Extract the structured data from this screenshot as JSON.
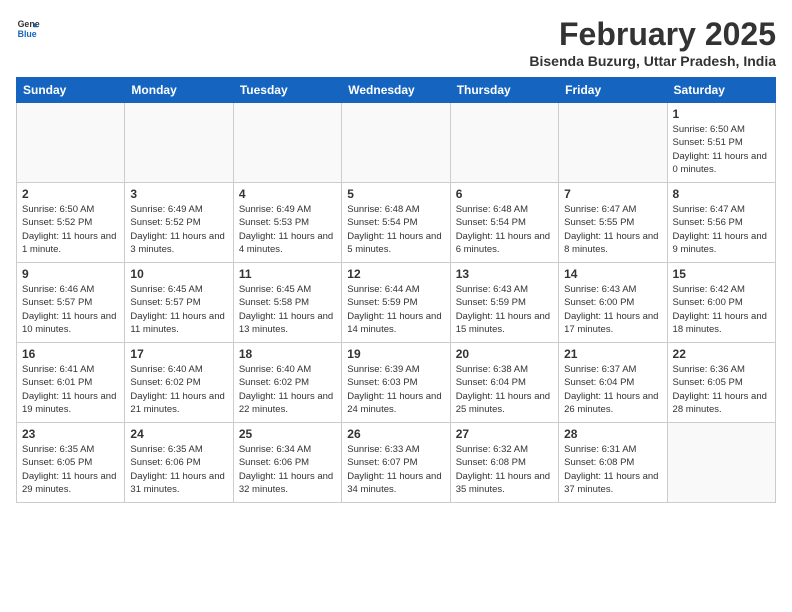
{
  "header": {
    "logo_general": "General",
    "logo_blue": "Blue",
    "month_title": "February 2025",
    "location": "Bisenda Buzurg, Uttar Pradesh, India"
  },
  "weekdays": [
    "Sunday",
    "Monday",
    "Tuesday",
    "Wednesday",
    "Thursday",
    "Friday",
    "Saturday"
  ],
  "weeks": [
    [
      {
        "day": "",
        "info": ""
      },
      {
        "day": "",
        "info": ""
      },
      {
        "day": "",
        "info": ""
      },
      {
        "day": "",
        "info": ""
      },
      {
        "day": "",
        "info": ""
      },
      {
        "day": "",
        "info": ""
      },
      {
        "day": "1",
        "info": "Sunrise: 6:50 AM\nSunset: 5:51 PM\nDaylight: 11 hours\nand 0 minutes."
      }
    ],
    [
      {
        "day": "2",
        "info": "Sunrise: 6:50 AM\nSunset: 5:52 PM\nDaylight: 11 hours\nand 1 minute."
      },
      {
        "day": "3",
        "info": "Sunrise: 6:49 AM\nSunset: 5:52 PM\nDaylight: 11 hours\nand 3 minutes."
      },
      {
        "day": "4",
        "info": "Sunrise: 6:49 AM\nSunset: 5:53 PM\nDaylight: 11 hours\nand 4 minutes."
      },
      {
        "day": "5",
        "info": "Sunrise: 6:48 AM\nSunset: 5:54 PM\nDaylight: 11 hours\nand 5 minutes."
      },
      {
        "day": "6",
        "info": "Sunrise: 6:48 AM\nSunset: 5:54 PM\nDaylight: 11 hours\nand 6 minutes."
      },
      {
        "day": "7",
        "info": "Sunrise: 6:47 AM\nSunset: 5:55 PM\nDaylight: 11 hours\nand 8 minutes."
      },
      {
        "day": "8",
        "info": "Sunrise: 6:47 AM\nSunset: 5:56 PM\nDaylight: 11 hours\nand 9 minutes."
      }
    ],
    [
      {
        "day": "9",
        "info": "Sunrise: 6:46 AM\nSunset: 5:57 PM\nDaylight: 11 hours\nand 10 minutes."
      },
      {
        "day": "10",
        "info": "Sunrise: 6:45 AM\nSunset: 5:57 PM\nDaylight: 11 hours\nand 11 minutes."
      },
      {
        "day": "11",
        "info": "Sunrise: 6:45 AM\nSunset: 5:58 PM\nDaylight: 11 hours\nand 13 minutes."
      },
      {
        "day": "12",
        "info": "Sunrise: 6:44 AM\nSunset: 5:59 PM\nDaylight: 11 hours\nand 14 minutes."
      },
      {
        "day": "13",
        "info": "Sunrise: 6:43 AM\nSunset: 5:59 PM\nDaylight: 11 hours\nand 15 minutes."
      },
      {
        "day": "14",
        "info": "Sunrise: 6:43 AM\nSunset: 6:00 PM\nDaylight: 11 hours\nand 17 minutes."
      },
      {
        "day": "15",
        "info": "Sunrise: 6:42 AM\nSunset: 6:00 PM\nDaylight: 11 hours\nand 18 minutes."
      }
    ],
    [
      {
        "day": "16",
        "info": "Sunrise: 6:41 AM\nSunset: 6:01 PM\nDaylight: 11 hours\nand 19 minutes."
      },
      {
        "day": "17",
        "info": "Sunrise: 6:40 AM\nSunset: 6:02 PM\nDaylight: 11 hours\nand 21 minutes."
      },
      {
        "day": "18",
        "info": "Sunrise: 6:40 AM\nSunset: 6:02 PM\nDaylight: 11 hours\nand 22 minutes."
      },
      {
        "day": "19",
        "info": "Sunrise: 6:39 AM\nSunset: 6:03 PM\nDaylight: 11 hours\nand 24 minutes."
      },
      {
        "day": "20",
        "info": "Sunrise: 6:38 AM\nSunset: 6:04 PM\nDaylight: 11 hours\nand 25 minutes."
      },
      {
        "day": "21",
        "info": "Sunrise: 6:37 AM\nSunset: 6:04 PM\nDaylight: 11 hours\nand 26 minutes."
      },
      {
        "day": "22",
        "info": "Sunrise: 6:36 AM\nSunset: 6:05 PM\nDaylight: 11 hours\nand 28 minutes."
      }
    ],
    [
      {
        "day": "23",
        "info": "Sunrise: 6:35 AM\nSunset: 6:05 PM\nDaylight: 11 hours\nand 29 minutes."
      },
      {
        "day": "24",
        "info": "Sunrise: 6:35 AM\nSunset: 6:06 PM\nDaylight: 11 hours\nand 31 minutes."
      },
      {
        "day": "25",
        "info": "Sunrise: 6:34 AM\nSunset: 6:06 PM\nDaylight: 11 hours\nand 32 minutes."
      },
      {
        "day": "26",
        "info": "Sunrise: 6:33 AM\nSunset: 6:07 PM\nDaylight: 11 hours\nand 34 minutes."
      },
      {
        "day": "27",
        "info": "Sunrise: 6:32 AM\nSunset: 6:08 PM\nDaylight: 11 hours\nand 35 minutes."
      },
      {
        "day": "28",
        "info": "Sunrise: 6:31 AM\nSunset: 6:08 PM\nDaylight: 11 hours\nand 37 minutes."
      },
      {
        "day": "",
        "info": ""
      }
    ]
  ]
}
